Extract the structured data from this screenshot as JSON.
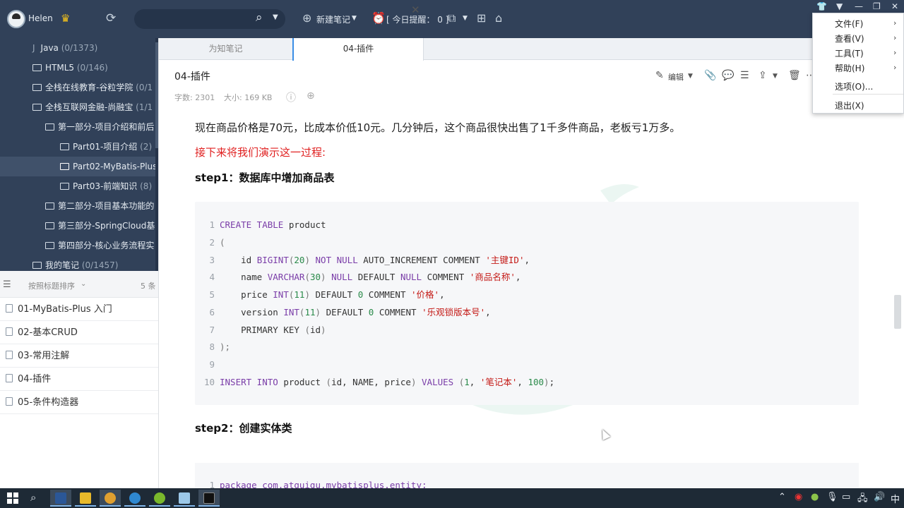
{
  "topbar": {
    "username": "Helen",
    "new_note_label": "新建笔记",
    "reminder_label": "[ 今日提醒： 0 ]"
  },
  "sidebar": {
    "items": [
      {
        "label": "Java",
        "count": "(0/1373)",
        "partial": true
      },
      {
        "label": "HTML5",
        "count": "(0/146)"
      },
      {
        "label": "全栈在线教育-谷粒学院",
        "count": "(0/1"
      },
      {
        "label": "全栈互联网金融-尚融宝",
        "count": "(1/1"
      },
      {
        "label": "第一部分-项目介绍和前后",
        "count": ""
      },
      {
        "label": "Part01-项目介绍",
        "count": "(2)"
      },
      {
        "label": "Part02-MyBatis-Plus",
        "count": "",
        "selected": true
      },
      {
        "label": "Part03-前端知识",
        "count": "(8)"
      },
      {
        "label": "第二部分-项目基本功能的",
        "count": ""
      },
      {
        "label": "第三部分-SpringCloud基",
        "count": ""
      },
      {
        "label": "第四部分-核心业务流程实",
        "count": ""
      },
      {
        "label": "我的笔记",
        "count": "(0/1457)"
      }
    ]
  },
  "notelist": {
    "sort_label": "按照标题排序",
    "count": "5 条",
    "notes": [
      "01-MyBatis-Plus 入门",
      "02-基本CRUD",
      "03-常用注解",
      "04-插件",
      "05-条件构造器"
    ]
  },
  "tabs": [
    {
      "label": "为知笔记"
    },
    {
      "label": "04-插件",
      "active": true
    }
  ],
  "doc": {
    "title": "04-插件",
    "word_count": "字数: 2301",
    "size": "大小: 169 KB",
    "edit_label": "编辑"
  },
  "content": {
    "para1": "现在商品价格是70元，比成本价低10元。几分钟后，这个商品很快出售了1千多件商品，老板亏1万多。",
    "para2": "接下来将我们演示这一过程:",
    "step1": "step1：数据库中增加商品表",
    "step2": "step2：创建实体类",
    "code2_line": "package com.atguigu.mybatisplus.entity;"
  },
  "code_lines": [
    {
      "n": "1",
      "t": "CREATE TABLE product"
    },
    {
      "n": "2",
      "t": "("
    },
    {
      "n": "3",
      "t": "    id BIGINT(20) NOT NULL AUTO_INCREMENT COMMENT '主键ID',"
    },
    {
      "n": "4",
      "t": "    name VARCHAR(30) NULL DEFAULT NULL COMMENT '商品名称',"
    },
    {
      "n": "5",
      "t": "    price INT(11) DEFAULT 0 COMMENT '价格',"
    },
    {
      "n": "6",
      "t": "    version INT(11) DEFAULT 0 COMMENT '乐观锁版本号',"
    },
    {
      "n": "7",
      "t": "    PRIMARY KEY (id)"
    },
    {
      "n": "8",
      "t": ");"
    },
    {
      "n": "9",
      "t": ""
    },
    {
      "n": "10",
      "t": "INSERT INTO product (id, NAME, price) VALUES (1, '笔记本', 100);"
    }
  ],
  "menu": {
    "items": [
      {
        "label": "文件(F)",
        "has_sub": true
      },
      {
        "label": "查看(V)",
        "has_sub": true
      },
      {
        "label": "工具(T)",
        "has_sub": true
      },
      {
        "label": "帮助(H)",
        "has_sub": true
      },
      {
        "label": "选项(O)...",
        "has_sub": false
      },
      {
        "label": "退出(X)",
        "has_sub": false
      }
    ]
  },
  "taskbar": {
    "ime": "中"
  },
  "colors": {
    "sidebar_bg": "#314159",
    "accent": "#3a8ee6",
    "red_text": "#e02020"
  }
}
